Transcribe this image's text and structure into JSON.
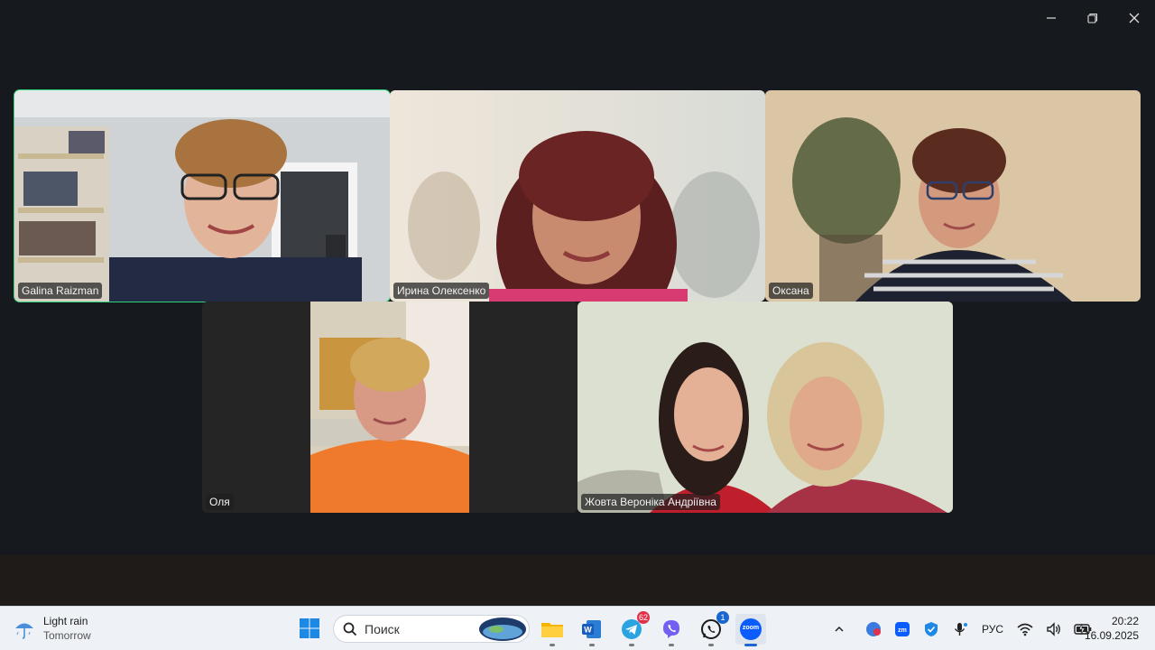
{
  "window": {
    "controls": [
      "minimize",
      "restore",
      "close"
    ]
  },
  "participants": [
    {
      "name": "Galina Raizman",
      "active": true
    },
    {
      "name": "Ирина Олексенко",
      "active": false
    },
    {
      "name": "Оксана",
      "active": false
    },
    {
      "name": "Оля",
      "active": false
    },
    {
      "name": "Жовта Вероніка Андріївна",
      "active": false
    }
  ],
  "taskbar": {
    "weather": {
      "line1": "Light rain",
      "line2": "Tomorrow"
    },
    "search": {
      "label": "Поиск"
    },
    "apps": [
      {
        "name": "file-explorer-icon"
      },
      {
        "name": "word-icon"
      },
      {
        "name": "telegram-icon",
        "badge": "62"
      },
      {
        "name": "viber-icon"
      },
      {
        "name": "whatsapp-icon",
        "badge": "1"
      },
      {
        "name": "zoom-icon",
        "label": "zoom",
        "active": true
      }
    ],
    "tray": {
      "language": "РУС"
    },
    "clock": {
      "time": "20:22",
      "date": "16.09.2025"
    }
  },
  "colors": {
    "active_speaker": "#2ed47a",
    "taskbar_bg": "#eef1f6",
    "stage_bg": "#16191d"
  }
}
